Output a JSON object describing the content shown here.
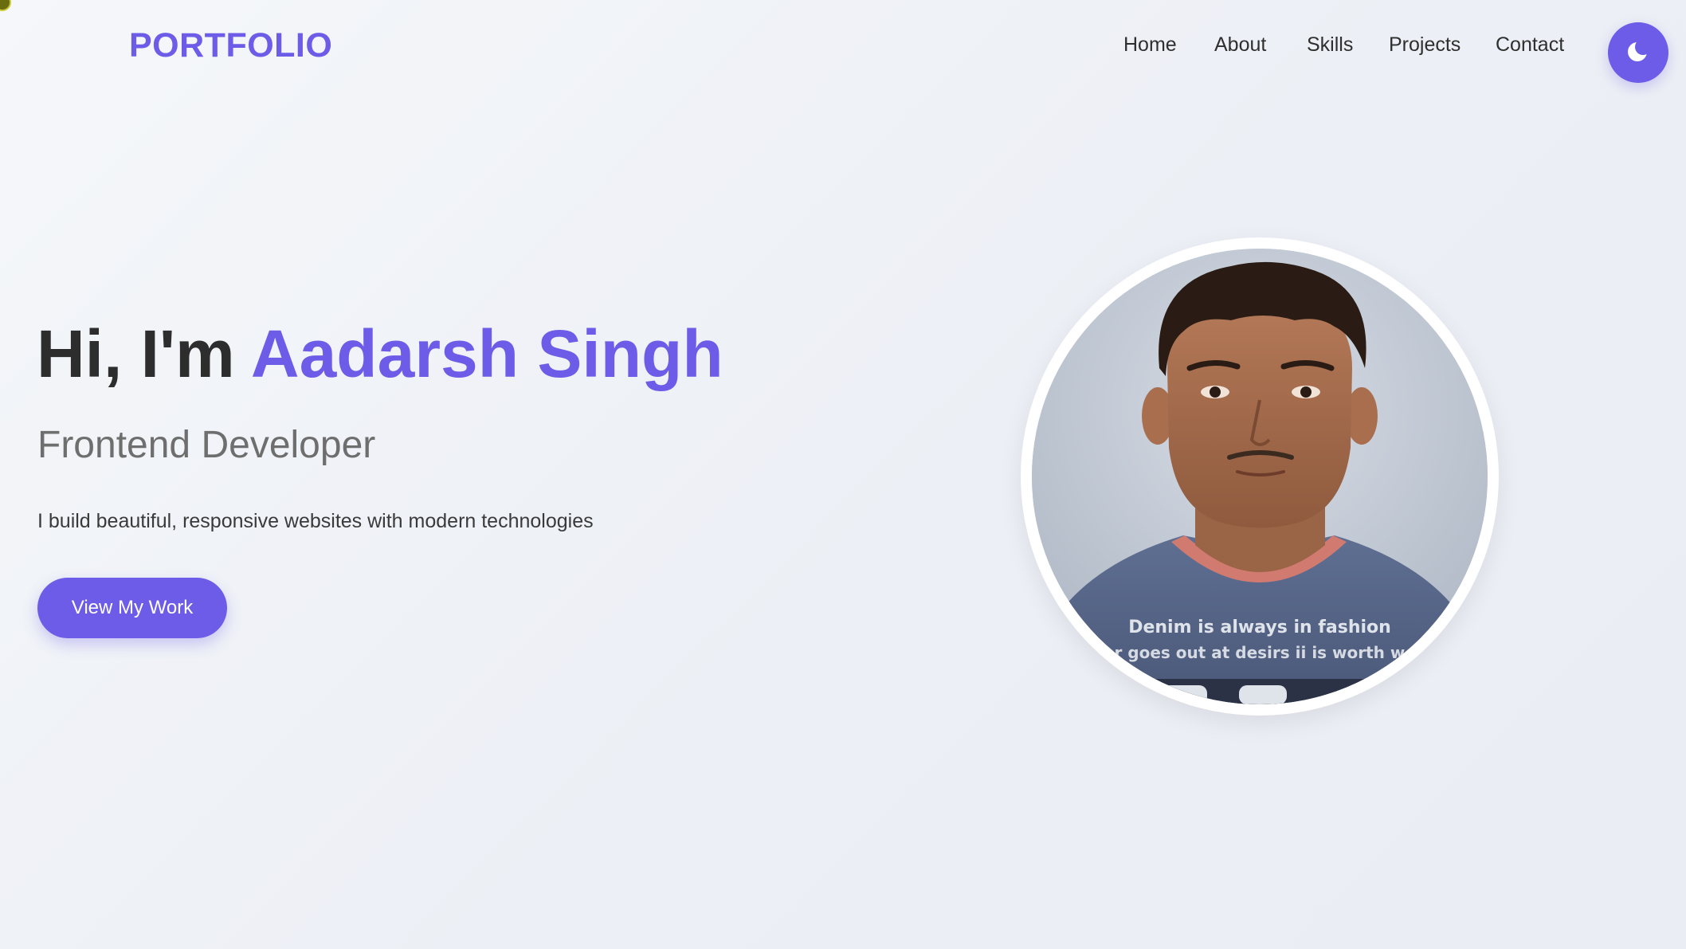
{
  "header": {
    "logo": "PORTFOLIO",
    "nav": {
      "home": "Home",
      "about": "About",
      "skills": "Skills",
      "projects": "Projects",
      "contact": "Contact"
    },
    "theme_toggle_icon": "moon-icon"
  },
  "hero": {
    "greeting": "Hi, I'm",
    "name": "Aadarsh Singh",
    "role": "Frontend Developer",
    "description": "I build beautiful, responsive websites with modern technologies",
    "cta_label": "View My Work"
  },
  "profile": {
    "shirt_text_line1": "Denim is always in fashion",
    "shirt_text_line2": "er goes out at desirs ii is worth wo"
  },
  "colors": {
    "accent": "#6c5ce7",
    "background": "#f3f5f9",
    "heading": "#2d2d2d",
    "muted": "#6e6e6e"
  }
}
